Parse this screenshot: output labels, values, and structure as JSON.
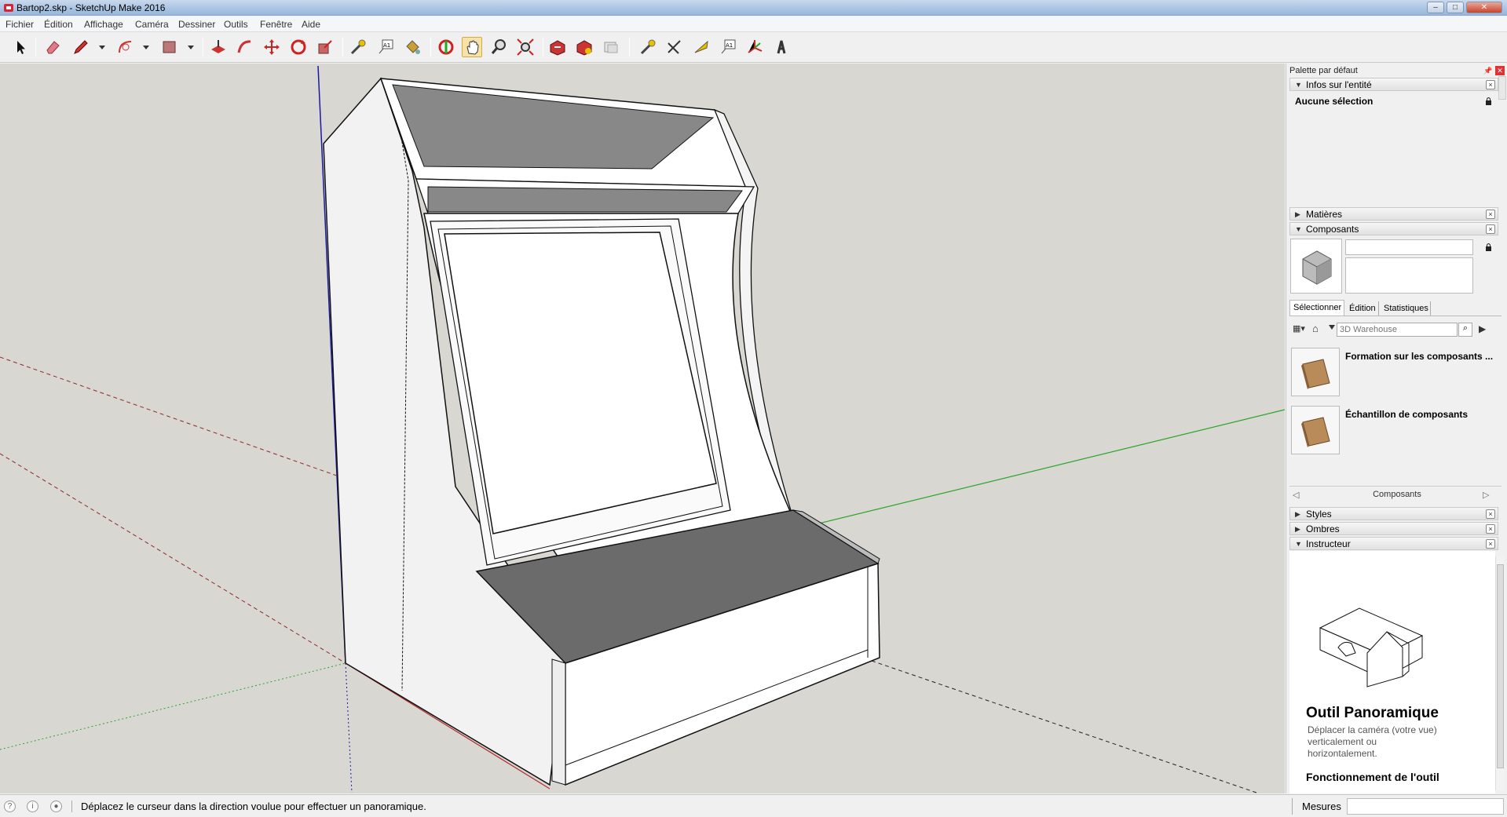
{
  "window": {
    "title": "Bartop2.skp - SketchUp Make 2016"
  },
  "menu": [
    "Fichier",
    "Édition",
    "Affichage",
    "Caméra",
    "Dessiner",
    "Outils",
    "Fenêtre",
    "Aide"
  ],
  "tray": {
    "title": "Palette par défaut",
    "entity_info": {
      "label": "Infos sur l'entité",
      "value": "Aucune sélection"
    },
    "materials": {
      "label": "Matières"
    },
    "components": {
      "label": "Composants",
      "tabs": [
        "Sélectionner",
        "Édition",
        "Statistiques"
      ],
      "search_placeholder": "3D Warehouse",
      "items": [
        "Formation sur les composants ...",
        "Échantillon de composants"
      ],
      "footer": "Composants"
    },
    "styles": {
      "label": "Styles"
    },
    "shadows": {
      "label": "Ombres"
    },
    "instructor": {
      "label": "Instructeur",
      "tool_title": "Outil Panoramique",
      "tool_desc": "Déplacer la caméra (votre vue) verticalement ou horizontalement.",
      "section": "Fonctionnement de l'outil"
    }
  },
  "status": {
    "message": "Déplacez le curseur dans la direction voulue pour effectuer un panoramique.",
    "measure_label": "Mesures"
  },
  "colors": {
    "active_tool": "#f8e3a6",
    "axis_green": "#2aa52a",
    "axis_red": "#b03030",
    "axis_blue": "#1a1aa0",
    "viewport_bg": "#d9d7d2"
  }
}
